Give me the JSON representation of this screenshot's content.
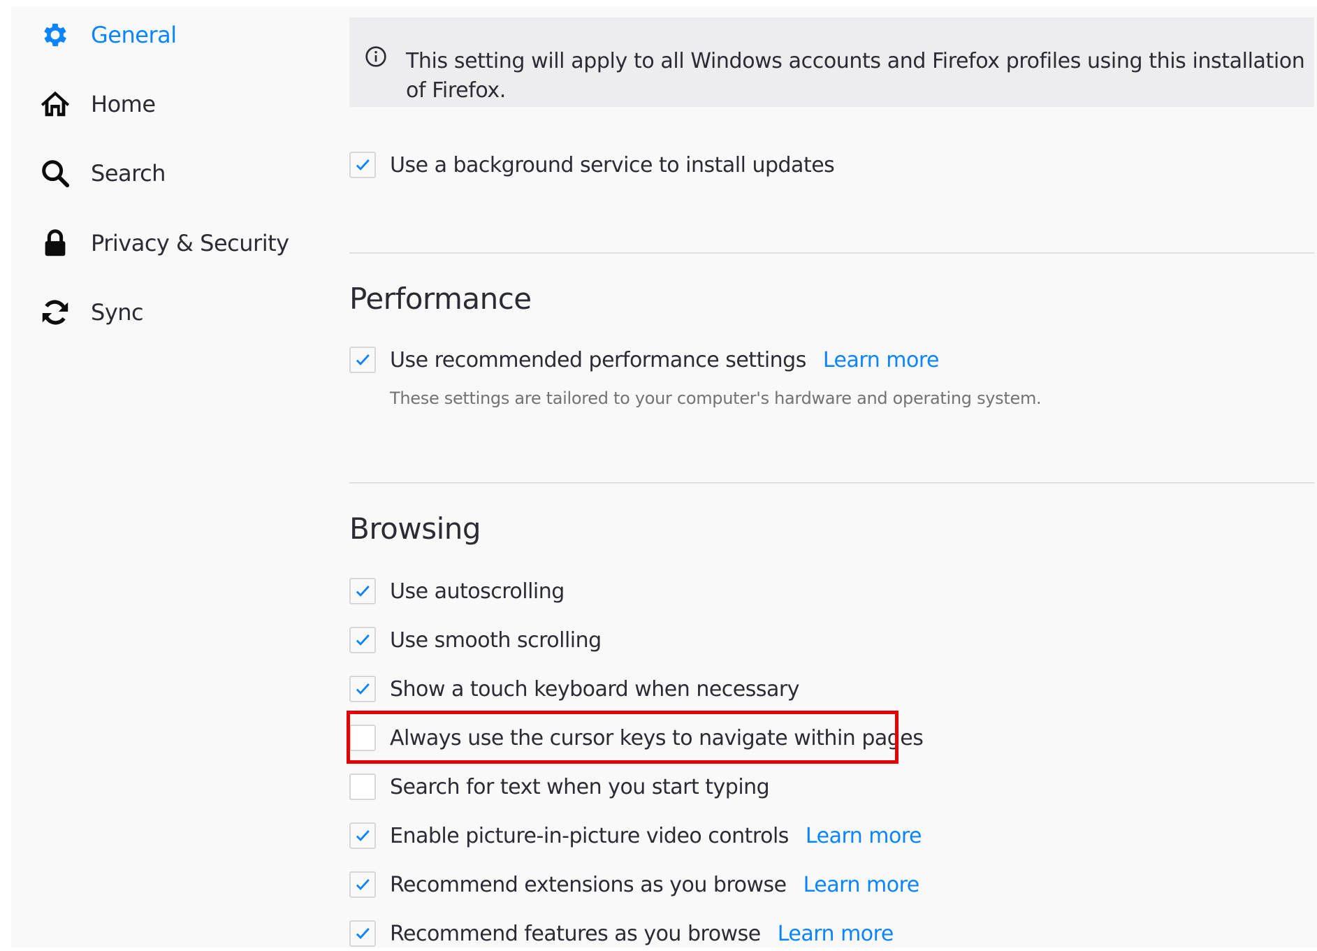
{
  "sidebar": {
    "items": [
      {
        "label": "General",
        "icon": "gear-icon",
        "active": true
      },
      {
        "label": "Home",
        "icon": "home-icon",
        "active": false
      },
      {
        "label": "Search",
        "icon": "search-icon",
        "active": false
      },
      {
        "label": "Privacy & Security",
        "icon": "lock-icon",
        "active": false
      },
      {
        "label": "Sync",
        "icon": "sync-icon",
        "active": false
      }
    ]
  },
  "notice": {
    "icon": "info-icon",
    "text": "This setting will apply to all Windows accounts and Firefox profiles using this installation of Firefox."
  },
  "updates": {
    "background_service": {
      "label": "Use a background service to install updates",
      "checked": true
    }
  },
  "performance": {
    "title": "Performance",
    "recommended": {
      "label": "Use recommended performance settings",
      "checked": true,
      "link": "Learn more"
    },
    "hint": "These settings are tailored to your computer's hardware and operating system."
  },
  "browsing": {
    "title": "Browsing",
    "options": [
      {
        "label": "Use autoscrolling",
        "checked": true
      },
      {
        "label": "Use smooth scrolling",
        "checked": true
      },
      {
        "label": "Show a touch keyboard when necessary",
        "checked": true
      },
      {
        "label": "Always use the cursor keys to navigate within pages",
        "checked": false,
        "highlighted": true
      },
      {
        "label": "Search for text when you start typing",
        "checked": false
      },
      {
        "label": "Enable picture-in-picture video controls",
        "checked": true,
        "link": "Learn more"
      },
      {
        "label": "Recommend extensions as you browse",
        "checked": true,
        "link": "Learn more"
      },
      {
        "label": "Recommend features as you browse",
        "checked": true,
        "link": "Learn more"
      }
    ]
  },
  "colors": {
    "accent": "#0a84ff",
    "highlight": "#e60000",
    "text": "#2b2b33",
    "notice_bg": "#ededf0"
  }
}
